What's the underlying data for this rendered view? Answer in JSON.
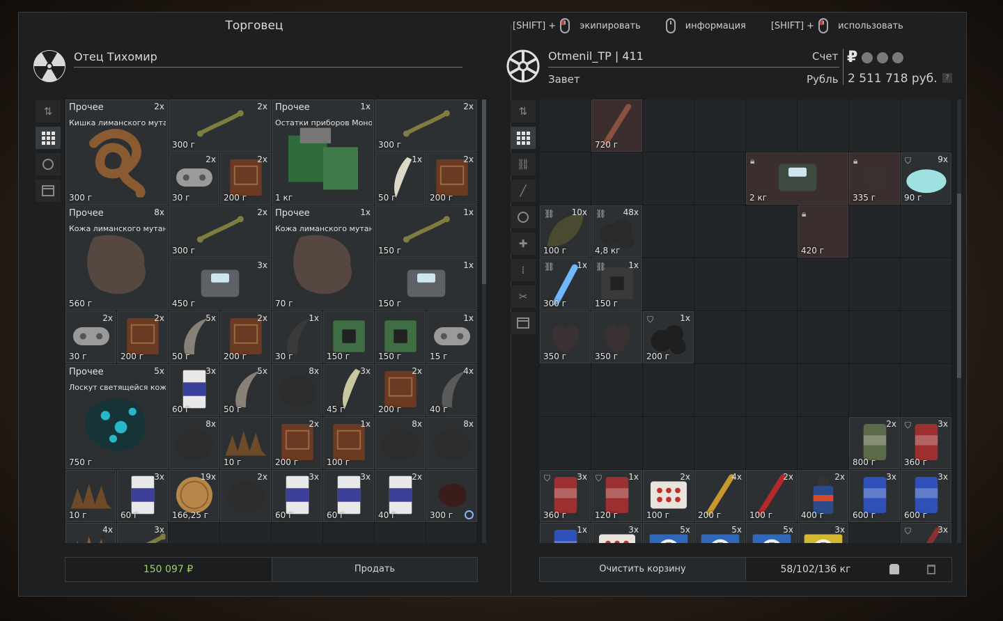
{
  "header": {
    "merchant_title": "Торговец",
    "hints": [
      {
        "key": "[SHIFT] +",
        "mouse": "left",
        "label": "экипировать"
      },
      {
        "key": "",
        "mouse": "middle",
        "label": "информация"
      },
      {
        "key": "[SHIFT] +",
        "mouse": "right",
        "label": "использовать"
      }
    ]
  },
  "trader": {
    "name": "Отец Тихомир",
    "icon": "radiation-icon"
  },
  "player": {
    "name": "Otmenil_TP  |  411",
    "faction": "Завет",
    "account_label": "Счет",
    "currency_label": "Рубль",
    "balance": "2 511 718 руб.",
    "currency_symbol": "₽",
    "help": "?"
  },
  "left_toolbar": [
    "sort-icon",
    "grid-icon",
    "artifact-icon",
    "box-icon"
  ],
  "right_toolbar": [
    "sort-icon",
    "grid-icon",
    "link-icon",
    "rifle-icon",
    "artifact-icon",
    "medkit-icon",
    "ammo-icon",
    "tools-icon",
    "box-icon"
  ],
  "trader_items": [
    {
      "r": 0,
      "c": 0,
      "w": 2,
      "h": 2,
      "cat": "Прочее",
      "name": "Кишка лиманского мута..",
      "count": "2x",
      "price": "300 г",
      "art": "gut",
      "color": "#8a5a30"
    },
    {
      "r": 0,
      "c": 2,
      "w": 2,
      "h": 1,
      "count": "2x",
      "price": "300 г",
      "art": "bone",
      "color": "#7e7d3f"
    },
    {
      "r": 1,
      "c": 2,
      "w": 1,
      "h": 1,
      "count": "2x",
      "price": "30 г",
      "art": "pad",
      "color": "#9a9a9a"
    },
    {
      "r": 1,
      "c": 3,
      "w": 1,
      "h": 1,
      "count": "2x",
      "price": "200 г",
      "art": "book",
      "color": "#6b3a22"
    },
    {
      "r": 0,
      "c": 4,
      "w": 2,
      "h": 2,
      "cat": "Прочее",
      "name": "Остатки приборов Моно..",
      "count": "1x",
      "price": "1 кг",
      "art": "boards",
      "color": "#2f6b3a"
    },
    {
      "r": 0,
      "c": 6,
      "w": 2,
      "h": 1,
      "count": "2x",
      "price": "300 г",
      "art": "bone",
      "color": "#7e7d3f"
    },
    {
      "r": 1,
      "c": 6,
      "w": 1,
      "h": 1,
      "count": "1x",
      "price": "50 г",
      "art": "tooth",
      "color": "#ddd8c8"
    },
    {
      "r": 1,
      "c": 7,
      "w": 1,
      "h": 1,
      "count": "2x",
      "price": "200 г",
      "art": "book",
      "color": "#6b3a22"
    },
    {
      "r": 2,
      "c": 0,
      "w": 2,
      "h": 2,
      "cat": "Прочее",
      "name": "Кожа лиманского мутан..",
      "count": "8x",
      "price": "560 г",
      "art": "hide",
      "color": "#5c4a42"
    },
    {
      "r": 2,
      "c": 2,
      "w": 2,
      "h": 1,
      "count": "2x",
      "price": "300 г",
      "art": "bone",
      "color": "#7e7d3f"
    },
    {
      "r": 3,
      "c": 2,
      "w": 2,
      "h": 1,
      "count": "3x",
      "price": "450 г",
      "art": "tin",
      "color": "#5e6266"
    },
    {
      "r": 2,
      "c": 4,
      "w": 2,
      "h": 2,
      "cat": "Прочее",
      "name": "Кожа лиманского мутан..",
      "count": "1x",
      "price": "70 г",
      "art": "hide",
      "color": "#5c4a42"
    },
    {
      "r": 2,
      "c": 6,
      "w": 2,
      "h": 1,
      "count": "1x",
      "price": "150 г",
      "art": "bone",
      "color": "#7e7d3f"
    },
    {
      "r": 3,
      "c": 6,
      "w": 2,
      "h": 1,
      "count": "1x",
      "price": "150 г",
      "art": "tin",
      "color": "#5e6266"
    },
    {
      "r": 4,
      "c": 0,
      "w": 1,
      "h": 1,
      "count": "2x",
      "price": "30 г",
      "art": "pad",
      "color": "#9a9a9a"
    },
    {
      "r": 4,
      "c": 1,
      "w": 1,
      "h": 1,
      "count": "2x",
      "price": "200 г",
      "art": "book",
      "color": "#6b3a22"
    },
    {
      "r": 4,
      "c": 2,
      "w": 1,
      "h": 1,
      "count": "5x",
      "price": "50 г",
      "art": "claw",
      "color": "#8a8176"
    },
    {
      "r": 4,
      "c": 3,
      "w": 1,
      "h": 1,
      "count": "2x",
      "price": "200 г",
      "art": "book",
      "color": "#6b3a22"
    },
    {
      "r": 4,
      "c": 4,
      "w": 1,
      "h": 1,
      "count": "1x",
      "price": "30 г",
      "art": "claw",
      "color": "#3a3a3a"
    },
    {
      "r": 4,
      "c": 5,
      "w": 1,
      "h": 1,
      "count": "",
      "price": "150 г",
      "art": "chip",
      "color": "#3f6e45"
    },
    {
      "r": 4,
      "c": 6,
      "w": 1,
      "h": 1,
      "count": "",
      "price": "150 г",
      "art": "chip",
      "color": "#3f6e45"
    },
    {
      "r": 4,
      "c": 7,
      "w": 1,
      "h": 1,
      "count": "1x",
      "price": "15 г",
      "art": "pad",
      "color": "#9a9a9a"
    },
    {
      "r": 5,
      "c": 0,
      "w": 2,
      "h": 2,
      "cat": "Прочее",
      "name": "Лоскут светящейся кож..",
      "count": "5x",
      "price": "750 г",
      "art": "glow",
      "color": "#28b7c9"
    },
    {
      "r": 5,
      "c": 2,
      "w": 1,
      "h": 1,
      "count": "3x",
      "price": "60 г",
      "art": "cigs",
      "color": "#3c3f9a"
    },
    {
      "r": 5,
      "c": 3,
      "w": 1,
      "h": 1,
      "count": "5x",
      "price": "50 г",
      "art": "claw",
      "color": "#8a8176"
    },
    {
      "r": 5,
      "c": 4,
      "w": 1,
      "h": 1,
      "count": "8x",
      "price": "",
      "art": "fur",
      "color": "#2c2c2c"
    },
    {
      "r": 5,
      "c": 5,
      "w": 1,
      "h": 1,
      "count": "3x",
      "price": "45 г",
      "art": "tooth",
      "color": "#c9c8a0"
    },
    {
      "r": 5,
      "c": 6,
      "w": 1,
      "h": 1,
      "count": "2x",
      "price": "200 г",
      "art": "book",
      "color": "#6b3a22"
    },
    {
      "r": 5,
      "c": 7,
      "w": 1,
      "h": 1,
      "count": "4x",
      "price": "40 г",
      "art": "claw",
      "color": "#5a5a5a"
    },
    {
      "r": 6,
      "c": 2,
      "w": 1,
      "h": 1,
      "count": "8x",
      "price": "",
      "art": "fur",
      "color": "#2c2c2c"
    },
    {
      "r": 6,
      "c": 3,
      "w": 1,
      "h": 1,
      "count": "",
      "price": "10 г",
      "art": "spikes",
      "color": "#6e4a28"
    },
    {
      "r": 6,
      "c": 4,
      "w": 1,
      "h": 1,
      "count": "2x",
      "price": "200 г",
      "art": "book",
      "color": "#6b3a22"
    },
    {
      "r": 6,
      "c": 5,
      "w": 1,
      "h": 1,
      "count": "1x",
      "price": "100 г",
      "art": "book",
      "color": "#6b3a22"
    },
    {
      "r": 6,
      "c": 6,
      "w": 1,
      "h": 1,
      "count": "8x",
      "price": "",
      "art": "fur",
      "color": "#2c2c2c"
    },
    {
      "r": 6,
      "c": 7,
      "w": 1,
      "h": 1,
      "count": "8x",
      "price": "",
      "art": "fur",
      "color": "#2c2c2c"
    },
    {
      "r": 7,
      "c": 0,
      "w": 1,
      "h": 1,
      "count": "",
      "price": "10 г",
      "art": "spikes",
      "color": "#6e4a28"
    },
    {
      "r": 7,
      "c": 1,
      "w": 1,
      "h": 1,
      "count": "3x",
      "price": "60 г",
      "art": "cigs",
      "color": "#3c3f9a"
    },
    {
      "r": 7,
      "c": 2,
      "w": 1,
      "h": 1,
      "count": "19x",
      "price": "166,25 г",
      "art": "coin",
      "color": "#b7874a"
    },
    {
      "r": 7,
      "c": 3,
      "w": 1,
      "h": 1,
      "count": "2x",
      "price": "",
      "art": "fur",
      "color": "#2c2c2c"
    },
    {
      "r": 7,
      "c": 4,
      "w": 1,
      "h": 1,
      "count": "3x",
      "price": "60 г",
      "art": "cigs",
      "color": "#3c3f9a"
    },
    {
      "r": 7,
      "c": 5,
      "w": 1,
      "h": 1,
      "count": "3x",
      "price": "60 г",
      "art": "cigs",
      "color": "#3c3f9a"
    },
    {
      "r": 7,
      "c": 6,
      "w": 1,
      "h": 1,
      "count": "2x",
      "price": "40 г",
      "art": "cigs",
      "color": "#3c3f9a"
    },
    {
      "r": 7,
      "c": 7,
      "w": 1,
      "h": 1,
      "count": "",
      "price": "300 г",
      "art": "blob",
      "color": "#3a1d1a",
      "clock": true
    },
    {
      "r": 8,
      "c": 0,
      "w": 1,
      "h": 1,
      "count": "4x",
      "price": "",
      "art": "spikes",
      "color": "#8a5a30"
    },
    {
      "r": 8,
      "c": 1,
      "w": 1,
      "h": 1,
      "count": "3x",
      "price": "",
      "art": "bone",
      "color": "#7e7d3f"
    }
  ],
  "player_items": [
    {
      "r": 0,
      "c": 1,
      "w": 1,
      "h": 1,
      "count": "",
      "price": "720 г",
      "art": "stick",
      "color": "#8a5040",
      "tint": "#3c2e2e"
    },
    {
      "r": 1,
      "c": 4,
      "w": 2,
      "h": 1,
      "count": "",
      "price": "2 кг",
      "art": "tin",
      "color": "#3e4a40",
      "lock": true,
      "tint": "#3a2e2e"
    },
    {
      "r": 1,
      "c": 6,
      "w": 1,
      "h": 1,
      "count": "",
      "price": "335 г",
      "art": "blob",
      "color": "#3a3030",
      "lock": true,
      "tint": "#3a2e2e"
    },
    {
      "r": 1,
      "c": 7,
      "w": 1,
      "h": 1,
      "count": "9x",
      "price": "90 г",
      "art": "salt",
      "color": "#9fe0e0",
      "shield": true
    },
    {
      "r": 2,
      "c": 0,
      "w": 1,
      "h": 1,
      "count": "10x",
      "price": "100 г",
      "art": "leaf",
      "color": "#4a4a30",
      "link": true
    },
    {
      "r": 2,
      "c": 1,
      "w": 1,
      "h": 1,
      "count": "48x",
      "price": "4,8 кг",
      "art": "lumps",
      "color": "#2a2a2a",
      "link": true
    },
    {
      "r": 2,
      "c": 5,
      "w": 1,
      "h": 1,
      "count": "",
      "price": "420 г",
      "art": "blob",
      "color": "#3a2e2e",
      "lock": true,
      "tint": "#3a2e2e"
    },
    {
      "r": 3,
      "c": 0,
      "w": 1,
      "h": 1,
      "count": "1x",
      "price": "300 г",
      "art": "syringe",
      "color": "#6fb7ff",
      "link": true
    },
    {
      "r": 3,
      "c": 1,
      "w": 1,
      "h": 1,
      "count": "1x",
      "price": "150 г",
      "art": "chip",
      "color": "#3a3a3a",
      "link": true
    },
    {
      "r": 4,
      "c": 0,
      "w": 1,
      "h": 1,
      "count": "",
      "price": "350 г",
      "art": "heart",
      "color": "#3a3232"
    },
    {
      "r": 4,
      "c": 1,
      "w": 1,
      "h": 1,
      "count": "",
      "price": "350 г",
      "art": "heart",
      "color": "#3a3232"
    },
    {
      "r": 4,
      "c": 2,
      "w": 1,
      "h": 1,
      "count": "1x",
      "price": "200 г",
      "art": "lumps",
      "color": "#1f1f1f",
      "shield": true
    },
    {
      "r": 6,
      "c": 6,
      "w": 1,
      "h": 1,
      "count": "2x",
      "price": "800 г",
      "art": "can",
      "color": "#5b6a48"
    },
    {
      "r": 6,
      "c": 7,
      "w": 1,
      "h": 1,
      "count": "3x",
      "price": "360 г",
      "art": "can",
      "color": "#9c3030",
      "shield": true
    },
    {
      "r": 7,
      "c": 0,
      "w": 1,
      "h": 1,
      "count": "3x",
      "price": "360 г",
      "art": "can",
      "color": "#9c3030",
      "shield": true
    },
    {
      "r": 7,
      "c": 1,
      "w": 1,
      "h": 1,
      "count": "1x",
      "price": "120 г",
      "art": "can",
      "color": "#9c3030",
      "shield": true
    },
    {
      "r": 7,
      "c": 2,
      "w": 1,
      "h": 1,
      "count": "2x",
      "price": "100 г",
      "art": "pills",
      "color": "#e8e3dc"
    },
    {
      "r": 7,
      "c": 3,
      "w": 1,
      "h": 1,
      "count": "4x",
      "price": "200 г",
      "art": "stick",
      "color": "#c8972e"
    },
    {
      "r": 7,
      "c": 4,
      "w": 1,
      "h": 1,
      "count": "2x",
      "price": "100 г",
      "art": "stick",
      "color": "#b22a2a"
    },
    {
      "r": 7,
      "c": 5,
      "w": 1,
      "h": 1,
      "count": "2x",
      "price": "400 г",
      "art": "bottle",
      "color": "#2a4a8a"
    },
    {
      "r": 7,
      "c": 6,
      "w": 1,
      "h": 1,
      "count": "3x",
      "price": "600 г",
      "art": "can",
      "color": "#2f50b8"
    },
    {
      "r": 7,
      "c": 7,
      "w": 1,
      "h": 1,
      "count": "3x",
      "price": "600 г",
      "art": "can",
      "color": "#2f50b8"
    },
    {
      "r": 8,
      "c": 0,
      "w": 1,
      "h": 1,
      "count": "1x",
      "price": "",
      "art": "can",
      "color": "#2f50b8"
    },
    {
      "r": 8,
      "c": 1,
      "w": 1,
      "h": 1,
      "count": "3x",
      "price": "",
      "art": "pills",
      "color": "#e8e3dc"
    },
    {
      "r": 8,
      "c": 2,
      "w": 1,
      "h": 1,
      "count": "5x",
      "price": "",
      "art": "medkit",
      "color": "#2f68b8"
    },
    {
      "r": 8,
      "c": 3,
      "w": 1,
      "h": 1,
      "count": "5x",
      "price": "",
      "art": "medkit",
      "color": "#2f68b8"
    },
    {
      "r": 8,
      "c": 4,
      "w": 1,
      "h": 1,
      "count": "5x",
      "price": "",
      "art": "medkit",
      "color": "#2f68b8"
    },
    {
      "r": 8,
      "c": 5,
      "w": 1,
      "h": 1,
      "count": "3x",
      "price": "",
      "art": "medkit",
      "color": "#d4b830"
    },
    {
      "r": 8,
      "c": 7,
      "w": 1,
      "h": 1,
      "count": "3x",
      "price": "",
      "art": "stick",
      "color": "#8a3030",
      "shield": true
    }
  ],
  "bottom": {
    "money": "150 097 ₽",
    "sell_label": "Продать",
    "clear_label": "Очистить корзину",
    "weight": "58/102/136 кг"
  }
}
